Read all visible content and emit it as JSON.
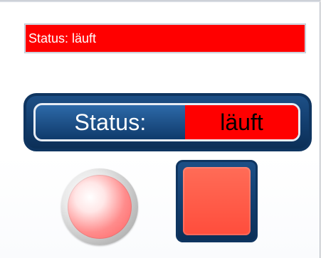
{
  "top_status_label": {
    "text": "Status: läuft",
    "background": "#ff0000",
    "text_color": "#ffffff"
  },
  "status_indicator": {
    "label": "Status:",
    "value": "läuft",
    "frame_color": "#123d6d",
    "value_background": "#ff0000",
    "label_text_color": "#ffffff",
    "value_text_color": "#000000"
  },
  "round_led": {
    "state_color": "#ff5f5f",
    "rim_color": "#bdbdbd"
  },
  "square_led": {
    "state_color": "#ff5b48",
    "frame_color": "#123d6d"
  }
}
